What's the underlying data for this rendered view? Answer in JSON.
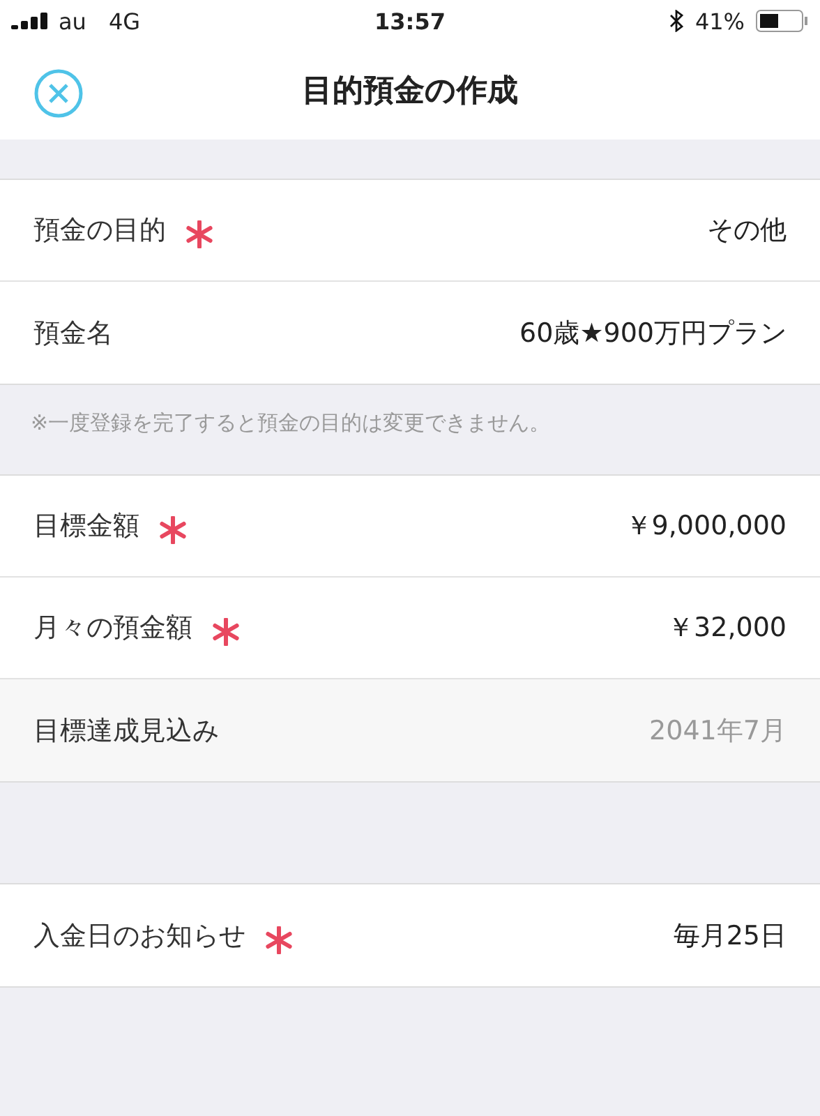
{
  "status_bar": {
    "carrier": "au",
    "network": "4G",
    "time": "13:57",
    "battery": "41%"
  },
  "nav": {
    "title": "目的預金の作成"
  },
  "sections": [
    {
      "rows": [
        {
          "label": "預金の目的",
          "required": true,
          "readonly": false,
          "value": "その他"
        },
        {
          "label": "預金名",
          "required": false,
          "readonly": false,
          "value": "60歳★900万円プラン"
        }
      ],
      "note": "※一度登録を完了すると預金の目的は変更できません。"
    },
    {
      "rows": [
        {
          "label": "目標金額",
          "required": true,
          "readonly": false,
          "value": "￥9,000,000"
        },
        {
          "label": "月々の預金額",
          "required": true,
          "readonly": false,
          "value": "￥32,000"
        },
        {
          "label": "目標達成見込み",
          "required": false,
          "readonly": true,
          "value": "2041年7月"
        }
      ]
    },
    {
      "rows": [
        {
          "label": "入金日のお知らせ",
          "required": true,
          "readonly": false,
          "value": "毎月25日"
        }
      ]
    }
  ]
}
